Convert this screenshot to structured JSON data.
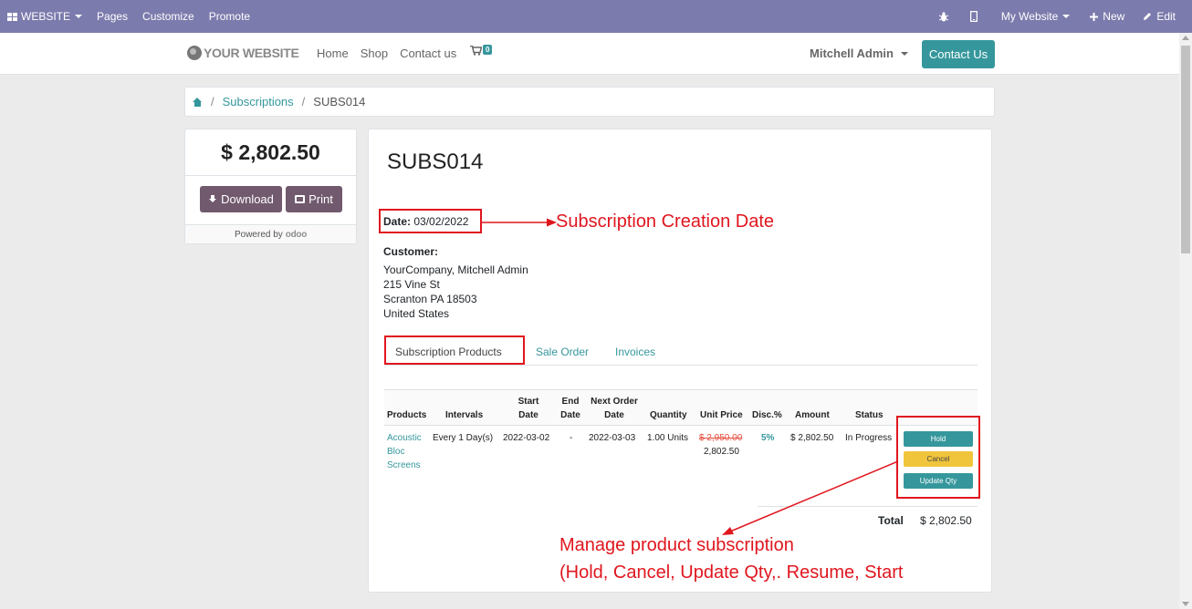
{
  "topbar": {
    "website_label": "WEBSITE",
    "menu": [
      "Pages",
      "Customize",
      "Promote"
    ],
    "bug_icon": "bug-icon",
    "mobile_icon": "mobile-icon",
    "my_website": "My Website",
    "new_label": "New",
    "edit_label": "Edit"
  },
  "site": {
    "logo_text": "YOUR WEBSITE",
    "nav": [
      "Home",
      "Shop",
      "Contact us"
    ],
    "cart_count": "0",
    "user_name": "Mitchell Admin",
    "contact_button": "Contact Us"
  },
  "breadcrumb": {
    "items": [
      "Subscriptions",
      "SUBS014"
    ]
  },
  "summary": {
    "amount": "$ 2,802.50",
    "download_label": "Download",
    "print_label": "Print",
    "powered_by": "Powered by",
    "odoo_brand": "odoo"
  },
  "subscription": {
    "title": "SUBS014",
    "date_label": "Date:",
    "date_value": "03/02/2022",
    "customer_label": "Customer:",
    "address": [
      "YourCompany, Mitchell Admin",
      "215 Vine St",
      "Scranton PA 18503",
      "United States"
    ]
  },
  "tabs": [
    "Subscription Products",
    "Sale Order",
    "Invoices"
  ],
  "table": {
    "headers": [
      "Products",
      "Intervals",
      "Start Date",
      "End Date",
      "Next Order Date",
      "Quantity",
      "Unit Price",
      "Disc.%",
      "Amount",
      "Status"
    ],
    "row": {
      "product": [
        "Acoustic",
        "Bloc",
        "Screens"
      ],
      "interval": "Every 1 Day(s)",
      "start": "2022-03-02",
      "end": "-",
      "next_order": "2022-03-03",
      "quantity": "1.00 Units",
      "unit_price_old": "$ 2,950.00",
      "unit_price": "2,802.50",
      "discount": "5%",
      "amount": "$ 2,802.50",
      "status": "In Progress"
    },
    "actions": [
      "Hold",
      "Cancel",
      "Update Qty"
    ],
    "total_label": "Total",
    "total_value": "$ 2,802.50"
  },
  "annotations": {
    "date_note": "Subscription Creation Date",
    "manage_note": "Manage product subscription",
    "manage_note_2": "(Hold, Cancel, Update Qty,. Resume, Start"
  },
  "colors": {
    "topbar": "#7c7bad",
    "accent": "#35979c",
    "dark_button": "#71596e",
    "annotation": "#e0161e"
  }
}
